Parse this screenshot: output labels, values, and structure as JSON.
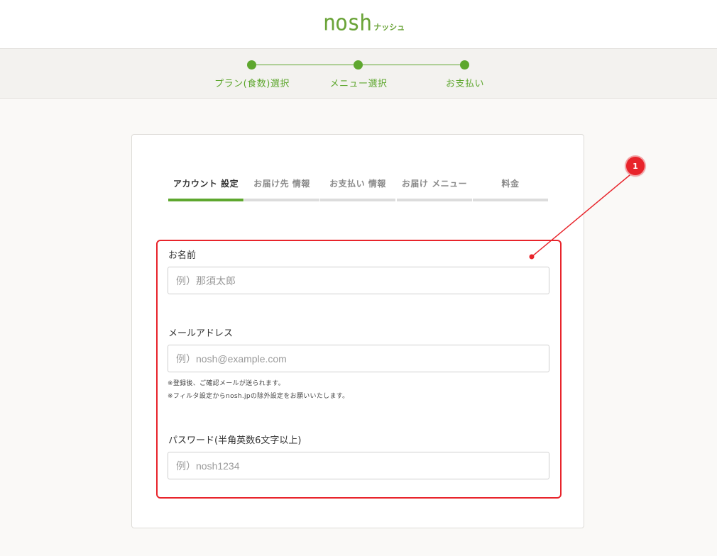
{
  "header": {
    "logo_text": "nosh",
    "logo_subtext": "ナッシュ"
  },
  "progress": {
    "steps": [
      {
        "label": "プラン(食数)選択"
      },
      {
        "label": "メニュー選択"
      },
      {
        "label": "お支払い"
      }
    ]
  },
  "tabs": [
    {
      "label": "アカウント 設定",
      "active": true
    },
    {
      "label": "お届け先 情報",
      "active": false
    },
    {
      "label": "お支払い 情報",
      "active": false
    },
    {
      "label": "お届け メニュー",
      "active": false
    },
    {
      "label": "料金",
      "active": false
    }
  ],
  "form": {
    "name": {
      "label": "お名前",
      "placeholder": "例）那須太郎",
      "value": ""
    },
    "email": {
      "label": "メールアドレス",
      "placeholder": "例）nosh@example.com",
      "value": "",
      "notes": [
        "※登録後、ご確認メールが送られます。",
        "※フィルタ設定からnosh.jpの除外設定をお願いいたします。"
      ]
    },
    "password": {
      "label": "パスワード(半角英数6文字以上)",
      "placeholder": "例）nosh1234",
      "value": ""
    }
  },
  "annotation": {
    "number": "1",
    "color": "#e8242b"
  },
  "colors": {
    "accent": "#5ea72e",
    "highlight": "#e8242b"
  }
}
